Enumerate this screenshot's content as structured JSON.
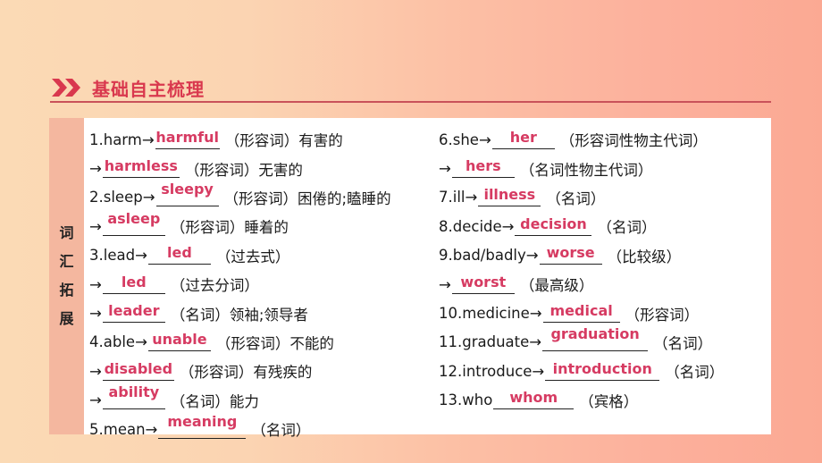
{
  "header": {
    "icon": "double-chevron-right-icon",
    "title": "基础自主梳理",
    "accent_color": "#d9384e"
  },
  "side_label": [
    "词",
    "汇",
    "拓",
    "展"
  ],
  "left_rows": [
    {
      "prefix": "1.harm→",
      "answer": "harmful",
      "note": "（形容词）有害的",
      "w": 72,
      "raised": false
    },
    {
      "prefix": "→",
      "answer": "harmless",
      "note": "（形容词）无害的",
      "w": 86,
      "raised": false
    },
    {
      "prefix": "2.sleep→",
      "answer": "sleepy",
      "note": "（形容词）困倦的;瞌睡的",
      "w": 70,
      "raised": true
    },
    {
      "prefix": "→",
      "answer": "asleep",
      "note": "（形容词）睡着的",
      "w": 70,
      "raised": true
    },
    {
      "prefix": "3.lead→",
      "answer": "led",
      "note": "（过去式）",
      "w": 70,
      "raised": false
    },
    {
      "prefix": "→",
      "answer": "led",
      "note": "（过去分词）",
      "w": 70,
      "raised": false
    },
    {
      "prefix": "→",
      "answer": "leader",
      "note": "（名词）领袖;领导者",
      "w": 70,
      "raised": false
    },
    {
      "prefix": "4.able→",
      "answer": "unable",
      "note": "（形容词）不能的",
      "w": 70,
      "raised": false
    },
    {
      "prefix": "→",
      "answer": "disabled",
      "note": "（形容词）有残疾的",
      "w": 80,
      "raised": false
    },
    {
      "prefix": "→",
      "answer": "ability",
      "note": "（名词）能力",
      "w": 70,
      "raised": true
    },
    {
      "prefix": "5.mean→",
      "answer": "meaning",
      "note": "（名词）",
      "w": 98,
      "raised": true
    }
  ],
  "right_rows": [
    {
      "prefix": "6.she→",
      "answer": "her",
      "note": "（形容词性物主代词）",
      "w": 70,
      "raised": false
    },
    {
      "prefix": "→",
      "answer": "hers",
      "note": "（名词性物主代词）",
      "w": 70,
      "raised": false
    },
    {
      "prefix": "7.ill→",
      "answer": "illness",
      "note": "（名词）",
      "w": 70,
      "raised": false
    },
    {
      "prefix": "8.decide→",
      "answer": "decision",
      "note": "（名词）",
      "w": 86,
      "raised": false
    },
    {
      "prefix": "9.bad/badly→",
      "answer": "worse",
      "note": "（比较级）",
      "w": 70,
      "raised": false
    },
    {
      "prefix": "→",
      "answer": "worst",
      "note": "（最高级）",
      "w": 70,
      "raised": false
    },
    {
      "prefix": "10.medicine→",
      "answer": "medical",
      "note": "（形容词）",
      "w": 86,
      "raised": false
    },
    {
      "prefix": "11.graduate→",
      "answer": "graduation",
      "note": "（名词）",
      "w": 118,
      "raised": true
    },
    {
      "prefix": "12.introduce→",
      "answer": "introduction",
      "note": "（名词）",
      "w": 128,
      "raised": false
    },
    {
      "prefix": "13.who ",
      "answer": "whom",
      "note": "（宾格）",
      "w": 90,
      "raised": false
    }
  ]
}
